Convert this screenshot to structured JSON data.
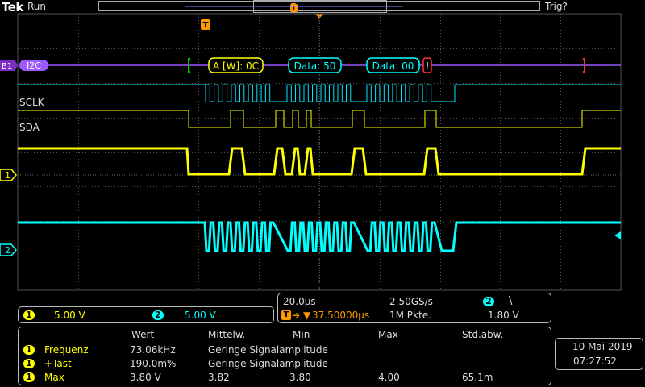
{
  "header": {
    "brand": "Tek",
    "run_state": "Run",
    "trigger_state": "Trig?"
  },
  "trigger_marker": "T",
  "bus": {
    "label": "B1",
    "name": "I2C",
    "packets": [
      "A [W]: 0C",
      "Data: 50",
      "Data: 00"
    ],
    "stop_marker": "!"
  },
  "traces": {
    "sclk": "SCLK",
    "sda": "SDA"
  },
  "channels": {
    "ch1": {
      "id": "1",
      "scale": "5.00 V",
      "color": "#ffff00"
    },
    "ch2": {
      "id": "2",
      "scale": "5.00 V",
      "color": "#00ffff"
    }
  },
  "horizontal": {
    "time_div": "20.0µs",
    "sample_rate": "2.50GS/s",
    "trigger_channel": "2",
    "trigger_slope_icon": "falling-edge",
    "trigger_slope_glyph": "\\",
    "position": "37.50000µs",
    "record_length": "1M Pkte.",
    "trigger_level": "1.80 V"
  },
  "measurements": {
    "headers": [
      "Wert",
      "Mittelw.",
      "Min",
      "Max",
      "Std.abw."
    ],
    "rows": [
      {
        "ch": "1",
        "name": "Frequenz",
        "wert": "73.06kHz",
        "mittel": "Geringe Signalamplitude",
        "min": "",
        "max": "",
        "std": ""
      },
      {
        "ch": "1",
        "name": "+Tast",
        "wert": "190.0m%",
        "mittel": "Geringe Signalamplitude",
        "min": "",
        "max": "",
        "std": ""
      },
      {
        "ch": "1",
        "name": "Max",
        "wert": "3.80 V",
        "mittel": "3.82",
        "min": "3.80",
        "max": "4.00",
        "std": "65.1m"
      }
    ]
  },
  "datetime": {
    "date": "10 Mai  2019",
    "time": "07:27:52"
  }
}
